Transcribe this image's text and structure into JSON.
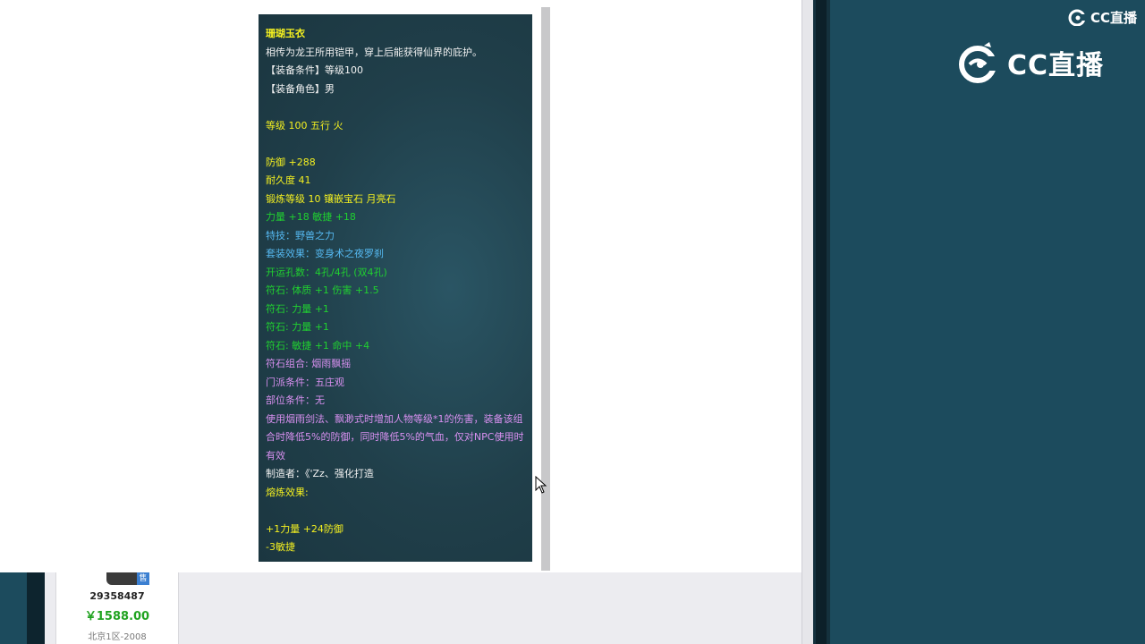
{
  "tooltip": {
    "lines": [
      {
        "text": "珊瑚玉衣",
        "color": "yellow",
        "bold": true
      },
      {
        "text": "相传为龙王所用铠甲，穿上后能获得仙界的庇护。",
        "color": "white"
      },
      {
        "text": "【装备条件】等级100",
        "color": "white"
      },
      {
        "text": "【装备角色】男",
        "color": "white"
      },
      {
        "text": "",
        "color": "white"
      },
      {
        "text": "等级 100  五行 火",
        "color": "yellow"
      },
      {
        "text": "",
        "color": "white"
      },
      {
        "text": "防御 +288",
        "color": "yellow"
      },
      {
        "text": "耐久度 41",
        "color": "yellow"
      },
      {
        "text": "锻炼等级 10  镶嵌宝石 月亮石",
        "color": "yellow"
      },
      {
        "text": "力量 +18 敏捷 +18",
        "color": "green"
      },
      {
        "text": "特技：野兽之力",
        "color": "blue"
      },
      {
        "text": "套装效果：变身术之夜罗刹",
        "color": "blue"
      },
      {
        "text": "开运孔数：4孔/4孔 (双4孔)",
        "color": "green"
      },
      {
        "text": "符石: 体质 +1 伤害 +1.5",
        "color": "green"
      },
      {
        "text": "符石: 力量 +1",
        "color": "green"
      },
      {
        "text": "符石: 力量 +1",
        "color": "green"
      },
      {
        "text": "符石: 敏捷 +1 命中 +4",
        "color": "green"
      },
      {
        "text": "符石组合: 烟雨飘摇",
        "color": "purple"
      },
      {
        "text": "门派条件：五庄观",
        "color": "purple"
      },
      {
        "text": "部位条件：无",
        "color": "purple"
      },
      {
        "text": "使用烟雨剑法、飘渺式时增加人物等级*1的伤害，装备该组合时降低5%的防御，同时降低5%的气血，仅对NPC使用时有效",
        "color": "purple",
        "wrap": true
      },
      {
        "text": "制造者：《'Zz、强化打造",
        "color": "white"
      },
      {
        "text": "熔炼效果:",
        "color": "yellow"
      },
      {
        "text": "",
        "color": "white"
      },
      {
        "text": "+1力量 +24防御",
        "color": "yellow"
      },
      {
        "text": "-3敏捷",
        "color": "yellow"
      }
    ]
  },
  "listing": {
    "badge": "售",
    "seller_id": "29358487",
    "price": "￥1588.00",
    "server": "北京1区-2008"
  },
  "logos": {
    "small": "CC直播",
    "big": "CC直播"
  },
  "colors": {
    "yellow": "#f4f020",
    "white": "#f2f2f2",
    "green": "#20d030",
    "blue": "#55b8f0",
    "purple": "#d890f0",
    "panel": "#1c4b5d"
  }
}
